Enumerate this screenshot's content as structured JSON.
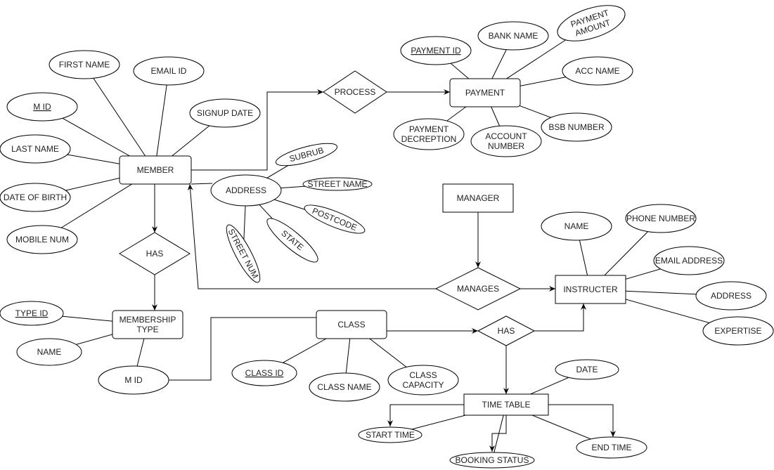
{
  "diagram": {
    "type": "er-diagram",
    "colors": {
      "stroke": "#000000",
      "fill": "#ffffff",
      "text": "#222222"
    },
    "entities": [
      {
        "id": "member",
        "label": "MEMBER"
      },
      {
        "id": "membership_type",
        "label": "MEMBERSHIP\nTYPE"
      },
      {
        "id": "class",
        "label": "CLASS"
      },
      {
        "id": "time_table",
        "label": "TIME TABLE"
      },
      {
        "id": "manager",
        "label": "MANAGER"
      },
      {
        "id": "instructer",
        "label": "INSTRUCTER"
      },
      {
        "id": "payment",
        "label": "PAYMENT"
      }
    ],
    "relationships": [
      {
        "id": "process",
        "label": "PROCESS"
      },
      {
        "id": "has1",
        "label": "HAS"
      },
      {
        "id": "has2",
        "label": "HAS"
      },
      {
        "id": "manages",
        "label": "MANAGES"
      }
    ],
    "attributes": [
      {
        "id": "first_name",
        "label": "FIRST NAME",
        "of": "member"
      },
      {
        "id": "email_id",
        "label": "EMAIL ID",
        "of": "member"
      },
      {
        "id": "m_id",
        "label": "M ID",
        "of": "member",
        "key": true
      },
      {
        "id": "signup_date",
        "label": "SIGNUP DATE",
        "of": "member"
      },
      {
        "id": "last_name",
        "label": "LAST NAME",
        "of": "member"
      },
      {
        "id": "dob",
        "label": "DATE OF BIRTH",
        "of": "member"
      },
      {
        "id": "mobile",
        "label": "MOBILE NUM",
        "of": "member"
      },
      {
        "id": "address",
        "label": "ADDRESS",
        "of": "member"
      },
      {
        "id": "subrub",
        "label": "SUBRUB",
        "of": "address"
      },
      {
        "id": "street_name",
        "label": "STREET NAME",
        "of": "address"
      },
      {
        "id": "postcode",
        "label": "POSTCODE",
        "of": "address"
      },
      {
        "id": "state",
        "label": "STATE",
        "of": "address"
      },
      {
        "id": "street_num",
        "label": "STREET NUM",
        "of": "address"
      },
      {
        "id": "type_id",
        "label": "TYPE ID",
        "of": "membership_type",
        "key": true
      },
      {
        "id": "mt_name",
        "label": "NAME",
        "of": "membership_type"
      },
      {
        "id": "mt_mid",
        "label": "M ID",
        "of": "membership_type"
      },
      {
        "id": "class_id",
        "label": "CLASS ID",
        "of": "class",
        "key": true
      },
      {
        "id": "class_name",
        "label": "CLASS NAME",
        "of": "class"
      },
      {
        "id": "class_capacity",
        "label": "CLASS\nCAPACITY",
        "of": "class"
      },
      {
        "id": "date",
        "label": "DATE",
        "of": "time_table"
      },
      {
        "id": "start_time",
        "label": "START TIME",
        "of": "time_table"
      },
      {
        "id": "booking_status",
        "label": "BOOKING STATUS",
        "of": "time_table"
      },
      {
        "id": "end_time",
        "label": "END TIME",
        "of": "time_table"
      },
      {
        "id": "i_name",
        "label": "NAME",
        "of": "instructer"
      },
      {
        "id": "phone",
        "label": "PHONE NUMBER",
        "of": "instructer"
      },
      {
        "id": "email_address",
        "label": "EMAIL ADDRESS",
        "of": "instructer"
      },
      {
        "id": "i_address",
        "label": "ADDRESS",
        "of": "instructer"
      },
      {
        "id": "expertise",
        "label": "EXPERTISE",
        "of": "instructer"
      },
      {
        "id": "payment_id",
        "label": "PAYMENT ID",
        "of": "payment",
        "key": true
      },
      {
        "id": "bank_name",
        "label": "BANK NAME",
        "of": "payment"
      },
      {
        "id": "payment_amount",
        "label": "PAYMENT\nAMOUNT",
        "of": "payment"
      },
      {
        "id": "acc_name",
        "label": "ACC NAME",
        "of": "payment"
      },
      {
        "id": "bsb",
        "label": "BSB NUMBER",
        "of": "payment"
      },
      {
        "id": "account_number",
        "label": "ACCOUNT\nNUMBER",
        "of": "payment"
      },
      {
        "id": "payment_desc",
        "label": "PAYMENT\nDECREPTION",
        "of": "payment"
      }
    ]
  }
}
